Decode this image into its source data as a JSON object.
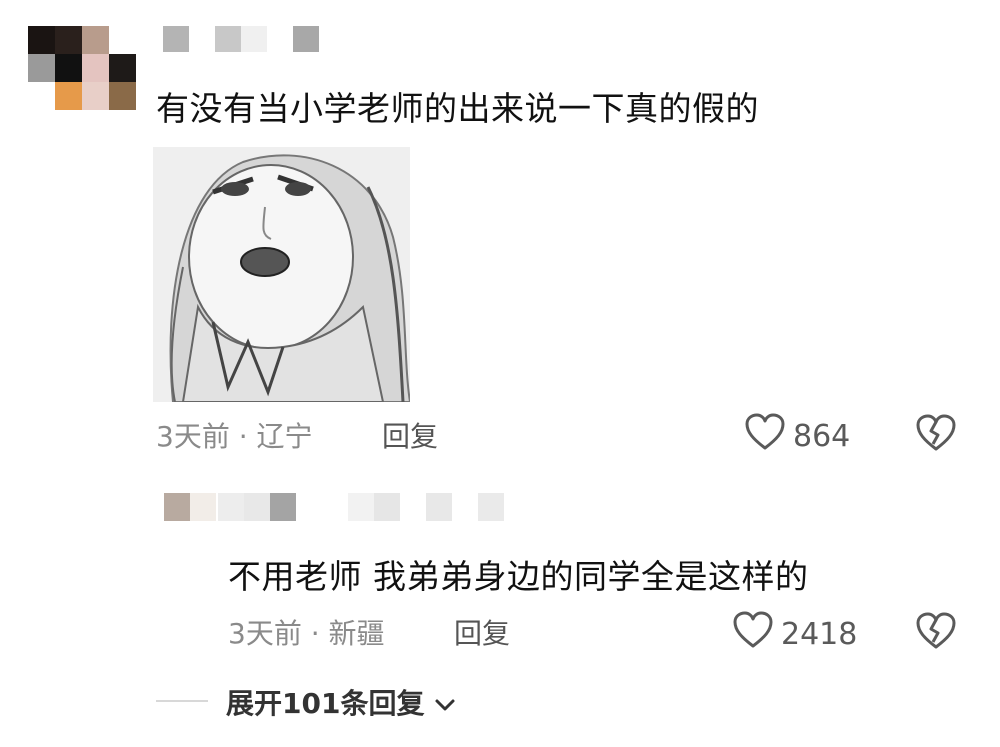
{
  "comments": [
    {
      "text": "有没有当小学老师的出来说一下真的假的",
      "time_location": "3天前 · 辽宁",
      "reply_label": "回复",
      "likes": "864",
      "replies": [
        {
          "text": "不用老师 我弟弟身边的同学全是这样的",
          "time_location": "3天前 · 新疆",
          "reply_label": "回复",
          "likes": "2418"
        }
      ],
      "expand_label": "展开101条回复"
    }
  ],
  "icons": {
    "like": "heart-outline-icon",
    "dislike": "broken-heart-icon",
    "expand": "chevron-down-icon"
  },
  "colors": {
    "text": "#111111",
    "meta": "#8a8a8a",
    "icon": "#5a5a5a"
  }
}
